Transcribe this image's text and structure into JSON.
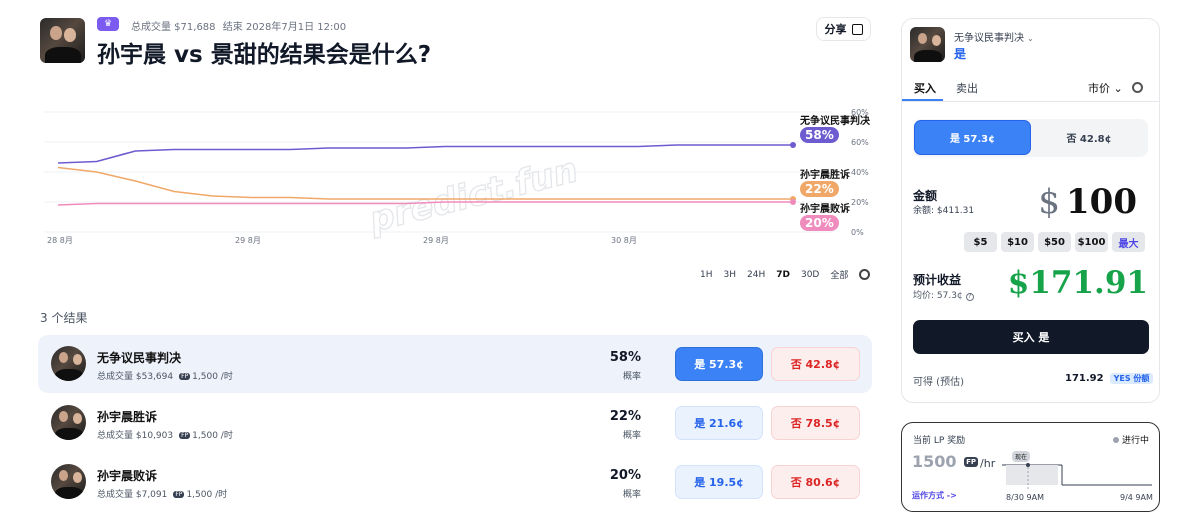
{
  "header": {
    "meta_volume": "总成交量 $71,688",
    "meta_end": "结束 2028年7月1日 12:00",
    "title": "孙宇晨 vs 景甜的结果会是什么?",
    "share_label": "分享"
  },
  "watermark": "predict.fun",
  "chart_data": {
    "type": "line",
    "x_ticks": [
      "28 8月",
      "29 8月",
      "29 8月",
      "30 8月"
    ],
    "y_ticks": [
      "60%",
      "60%",
      "40%",
      "20%",
      "0%"
    ],
    "ylim": [
      0,
      80
    ],
    "series": [
      {
        "name": "无争议民事判决",
        "color": "#6d5bd0",
        "label": "58%",
        "values": [
          46,
          47,
          54,
          55,
          55,
          55,
          55,
          56,
          56,
          56,
          57,
          57,
          57,
          57,
          57,
          57,
          58,
          58,
          58,
          58
        ]
      },
      {
        "name": "孙宇晨胜诉",
        "color": "#f0a868",
        "label": "22%",
        "values": [
          43,
          40,
          34,
          27,
          24,
          23,
          23,
          22,
          22,
          22,
          22,
          22,
          22,
          22,
          22,
          22,
          22,
          22,
          22,
          22
        ]
      },
      {
        "name": "孙宇晨败诉",
        "color": "#f08bbd",
        "label": "20%",
        "values": [
          18,
          19,
          19,
          19,
          19,
          19,
          19,
          19,
          19,
          19,
          20,
          20,
          20,
          20,
          20,
          20,
          20,
          20,
          20,
          20
        ]
      }
    ]
  },
  "range_tabs": [
    "1H",
    "3H",
    "24H",
    "7D",
    "30D",
    "全部"
  ],
  "range_active": "7D",
  "outcomes_count": "3 个结果",
  "outcomes": [
    {
      "name": "无争议民事判决",
      "volume": "总成交量 $53,694",
      "lp": "1,500 /时",
      "pct": "58%",
      "prob": "概率",
      "yes": "是 57.3¢",
      "no": "否 42.8¢"
    },
    {
      "name": "孙宇晨胜诉",
      "volume": "总成交量 $10,903",
      "lp": "1,500 /时",
      "pct": "22%",
      "prob": "概率",
      "yes": "是 21.6¢",
      "no": "否 78.5¢"
    },
    {
      "name": "孙宇晨败诉",
      "volume": "总成交量 $7,091",
      "lp": "1,500 /时",
      "pct": "20%",
      "prob": "概率",
      "yes": "是 19.5¢",
      "no": "否 80.6¢"
    }
  ],
  "lp_tag": "FP",
  "panel": {
    "market": "无争议民事判决",
    "side": "是",
    "tab_buy": "买入",
    "tab_sell": "卖出",
    "order_type": "市价",
    "yes_label": "是 57.3¢",
    "no_label": "否 42.8¢",
    "amount_label": "金额",
    "balance": "余额: $411.31",
    "currency": "$",
    "amount": "100",
    "quick": [
      "$5",
      "$10",
      "$50",
      "$100",
      "最大"
    ],
    "est_label": "预计收益",
    "avg_price": "均价: 57.3¢",
    "est_value": "$171.91",
    "buy_button": "买入 是",
    "payout_label": "可得 (预估)",
    "payout_value": "171.92",
    "payout_unit": "YES 份额"
  },
  "lp_box": {
    "title": "当前 LP 奖励",
    "status": "进行中",
    "rate": "1500",
    "rate_unit": "/hr",
    "link": "运作方式 ->",
    "now": "现在",
    "t1": "8/30 9AM",
    "t2": "9/4 9AM"
  },
  "colors": {
    "accent": "#3b82f6",
    "purple": "#7c5cf0",
    "green": "#16a34a",
    "red": "#dc2626"
  }
}
